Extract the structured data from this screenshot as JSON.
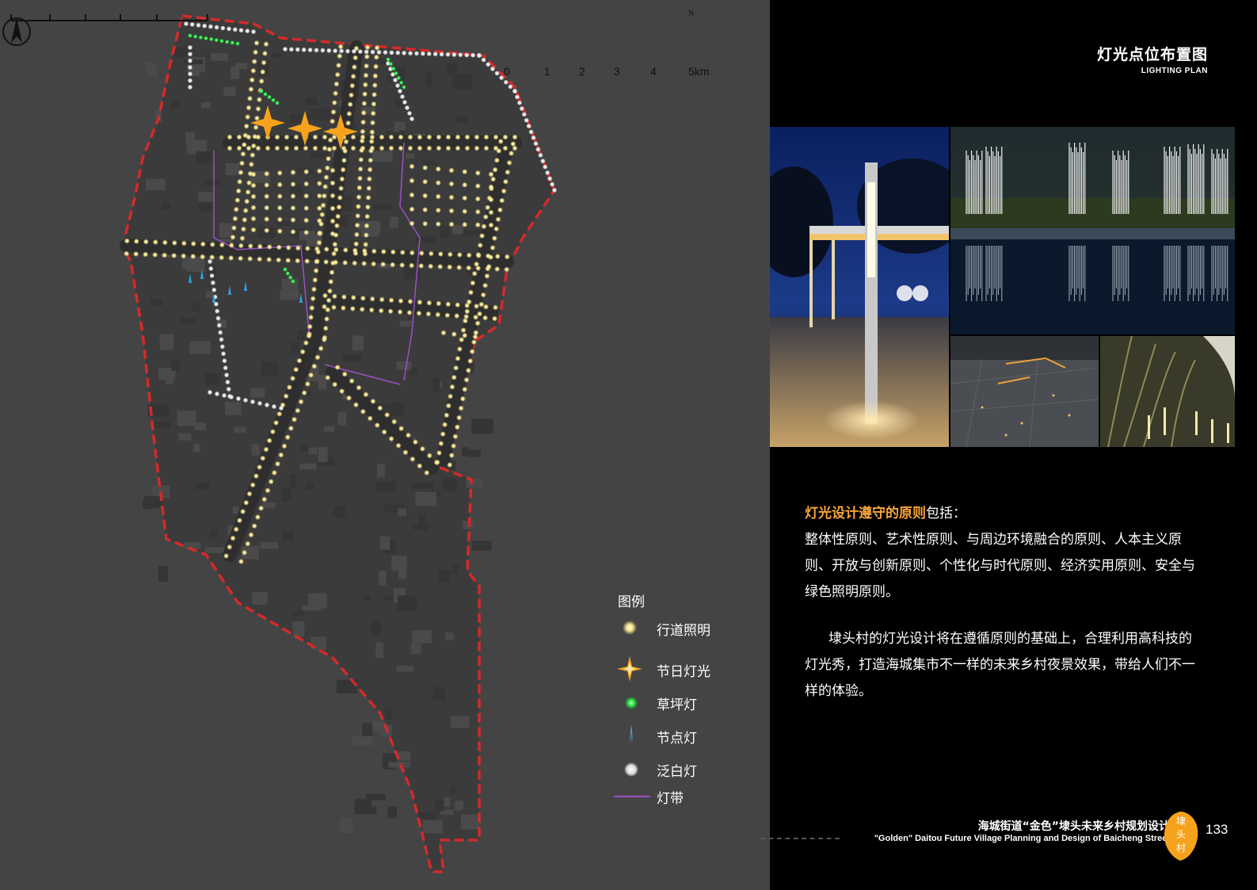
{
  "header": {
    "title_cn": "灯光点位布置图",
    "title_en": "LIGHTING PLAN"
  },
  "map": {
    "compass_label": "N",
    "scale_labels": [
      "0",
      "1",
      "2",
      "3",
      "4",
      "5km"
    ],
    "colors": {
      "background": "#444444",
      "boundary": "#d42a2a",
      "road_light": "#f5e38a",
      "festival_light": "#f6a21c",
      "lawn_light": "#1ed83a",
      "node_light": "#2aa6e0",
      "flood_light": "#ffffff",
      "light_strip": "#9b4fc4"
    },
    "legend": {
      "title": "图例",
      "items": [
        {
          "icon": "road-light-icon",
          "label": "行道照明"
        },
        {
          "icon": "festival-light-icon",
          "label": "节日灯光"
        },
        {
          "icon": "lawn-light-icon",
          "label": "草坪灯"
        },
        {
          "icon": "node-light-icon",
          "label": "节点灯"
        },
        {
          "icon": "flood-light-icon",
          "label": "泛白灯"
        },
        {
          "icon": "light-strip-icon",
          "label": "灯带"
        }
      ]
    }
  },
  "content": {
    "principles_highlight": "灯光设计遵守的原则",
    "principles_suffix": "包括：",
    "principles_body": "整体性原则、艺术性原则、与周边环境融合的原则、人本主义原则、开放与创新原则、个性化与时代原则、经济实用原则、安全与绿色照明原则。",
    "description": "埭头村的灯光设计将在遵循原则的基础上，合理利用高科技的灯光秀，打造海城集市不一样的未来乡村夜景效果，带给人们不一样的体验。"
  },
  "footer": {
    "title_cn": "海城街道“金色”埭头未来乡村规划设计",
    "title_en": "\"Golden\" Daitou Future Village Planning and Design of Baicheng Street",
    "badge_text": "埭头村",
    "page_number": "133"
  }
}
